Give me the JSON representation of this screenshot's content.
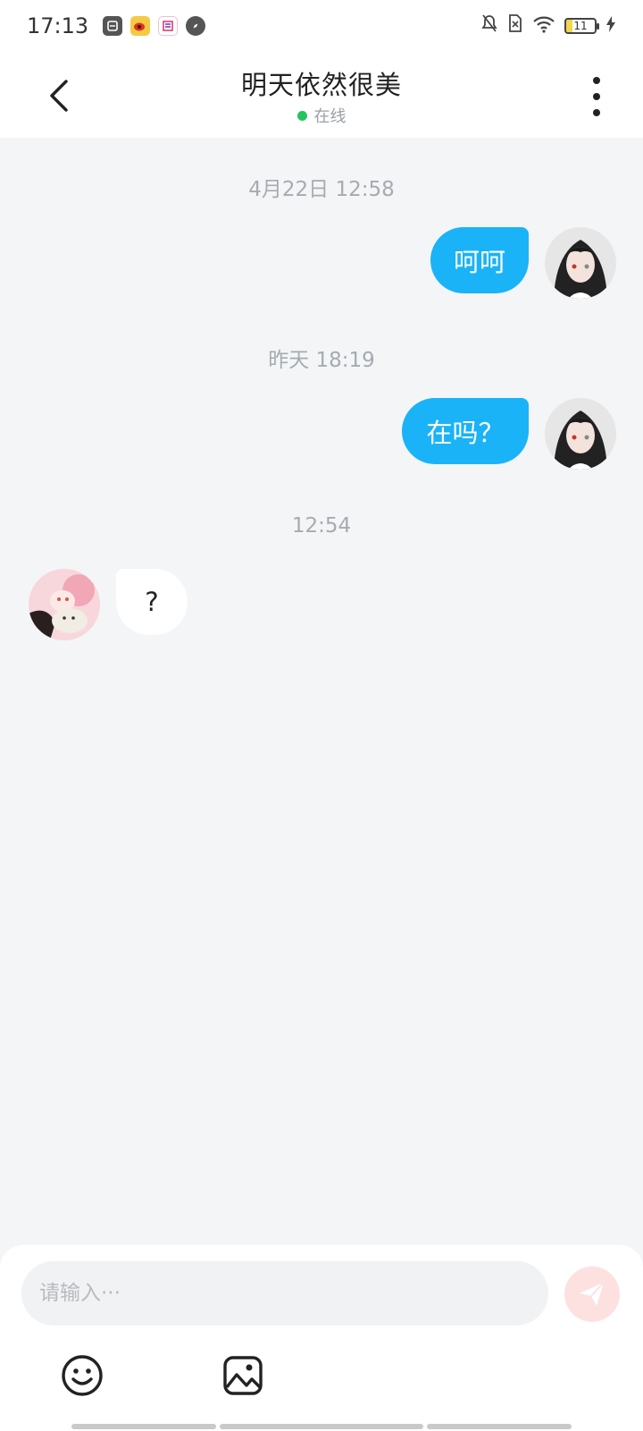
{
  "status_bar": {
    "time": "17:13",
    "app_icons": [
      "app-icon",
      "weibo-icon",
      "app-icon",
      "compass-icon"
    ],
    "battery_level": "11"
  },
  "header": {
    "title": "明天依然很美",
    "status": "在线",
    "status_color": "#22c55e"
  },
  "messages": [
    {
      "timestamp": "4月22日 12:58",
      "sender": "me",
      "text": "呵呵"
    },
    {
      "timestamp": "昨天 18:19",
      "sender": "me",
      "text": "在吗？"
    },
    {
      "timestamp": "12:54",
      "sender": "them",
      "text": "?"
    }
  ],
  "composer": {
    "placeholder": "请输入···",
    "send_icon": "send-icon",
    "tools": [
      "emoji-icon",
      "image-icon"
    ]
  },
  "colors": {
    "my_bubble": "#1ab3f7",
    "their_bubble": "#ffffff",
    "send_button": "#fde1e1",
    "background": "#f4f5f7"
  }
}
